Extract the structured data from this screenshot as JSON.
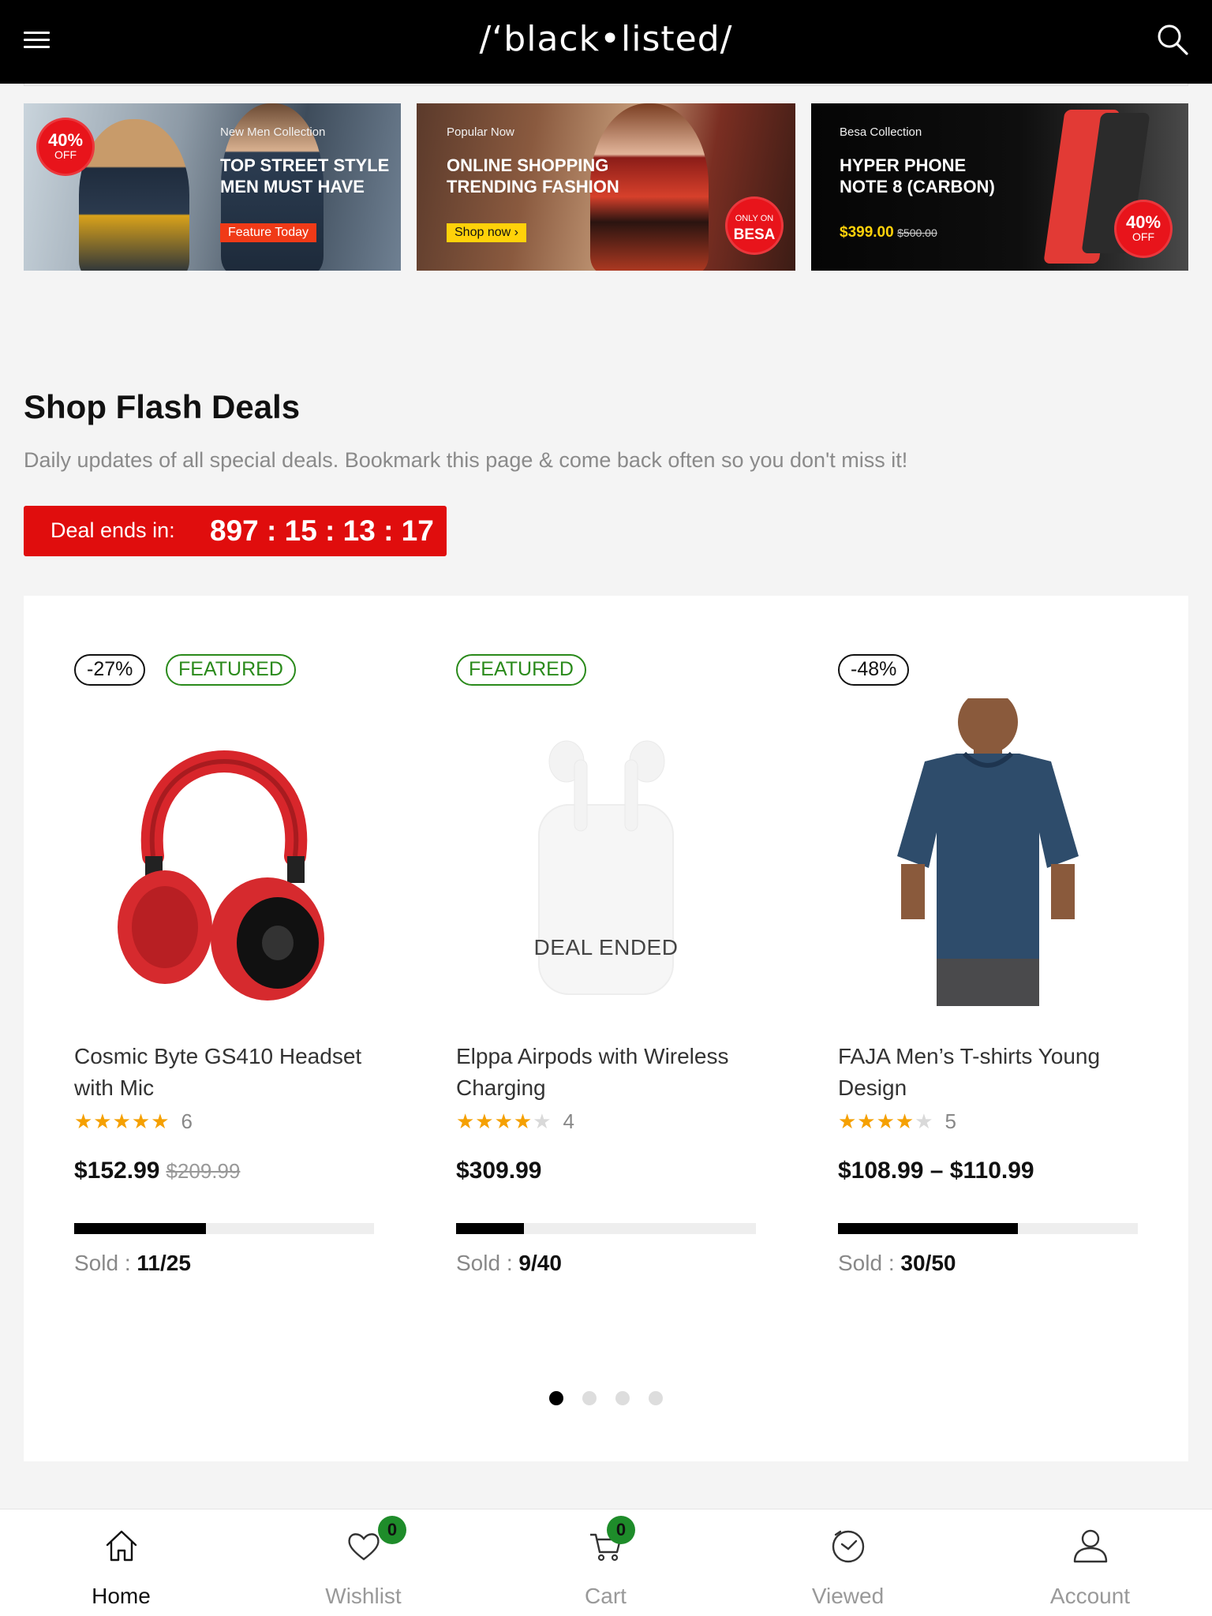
{
  "header": {
    "logo": "/‘black•listed/"
  },
  "banners": [
    {
      "pretitle": "New Men Collection",
      "heading_line1": "TOP STREET STYLE",
      "heading_line2": "MEN MUST HAVE",
      "button": "Feature Today",
      "discount_big": "40%",
      "discount_small": "OFF"
    },
    {
      "pretitle": "Popular Now",
      "heading_line1": "ONLINE SHOPPING",
      "heading_line2": "TRENDING FASHION",
      "button": "Shop now ›",
      "badge_small": "ONLY ON",
      "badge_big": "BESA"
    },
    {
      "pretitle": "Besa Collection",
      "heading_line1": "HYPER PHONE",
      "heading_line2": "NOTE 8 (CARBON)",
      "price": "$399.00",
      "old_price": "$500.00",
      "discount_big": "40%",
      "discount_small": "OFF"
    }
  ],
  "section": {
    "title": "Shop Flash Deals",
    "subtitle": "Daily updates of all special deals. Bookmark this page & come back often so you don't miss it!",
    "countdown_label": "Deal ends in:",
    "countdown_time": "897 : 15 : 13 : 17"
  },
  "products": [
    {
      "discount": "-27%",
      "featured": "FEATURED",
      "name": "Cosmic Byte GS410 Headset with Mic",
      "rating": 5,
      "reviews": "6",
      "price": "$152.99",
      "old_price": "$209.99",
      "sold_label": "Sold : ",
      "sold_value": "11/25",
      "sold_fraction": 0.44
    },
    {
      "featured": "FEATURED",
      "overlay": "DEAL ENDED",
      "name": "Elppa Airpods with Wireless Charging",
      "rating": 4,
      "reviews": "4",
      "price": "$309.99",
      "sold_label": "Sold : ",
      "sold_value": "9/40",
      "sold_fraction": 0.225
    },
    {
      "discount": "-48%",
      "name": "FAJA Men’s T-shirts Young Design",
      "rating": 4,
      "reviews": "5",
      "price": "$108.99 – $110.99",
      "sold_label": "Sold : ",
      "sold_value": "30/50",
      "sold_fraction": 0.6
    }
  ],
  "pagination": {
    "pages": 4,
    "active": 1
  },
  "bottom_nav": {
    "home": "Home",
    "wishlist": "Wishlist",
    "wishlist_count": "0",
    "cart": "Cart",
    "cart_count": "0",
    "viewed": "Viewed",
    "account": "Account"
  },
  "colors": {
    "accent_red": "#e00d0d",
    "featured_green": "#2a8a1b",
    "star": "#f5a000",
    "badge_green": "#1e8c2a"
  }
}
